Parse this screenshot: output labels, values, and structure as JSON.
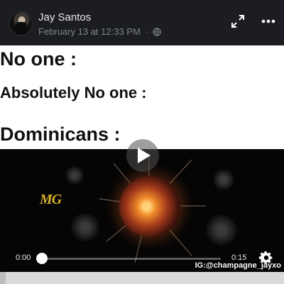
{
  "post": {
    "author": "Jay Santos",
    "timestamp": "February 13 at 12:33 PM",
    "separator": "·",
    "privacy_icon": "globe-icon",
    "expand_icon": "expand-icon",
    "more_icon": "more-icon"
  },
  "meme": {
    "line1": "No one :",
    "line2": "Absolutely No one :",
    "line3": "Dominicans :"
  },
  "video": {
    "logo_text": "MG",
    "time_current": "0:00",
    "time_total": "0:15",
    "progress_fraction": 0.02,
    "watermark": "IG:@champagne_jayxo",
    "play_icon": "play-icon",
    "settings_icon": "gear-icon"
  },
  "colors": {
    "background": "#1b1d22",
    "meme_bg": "#ffffff",
    "logo": "#d8b02a"
  }
}
